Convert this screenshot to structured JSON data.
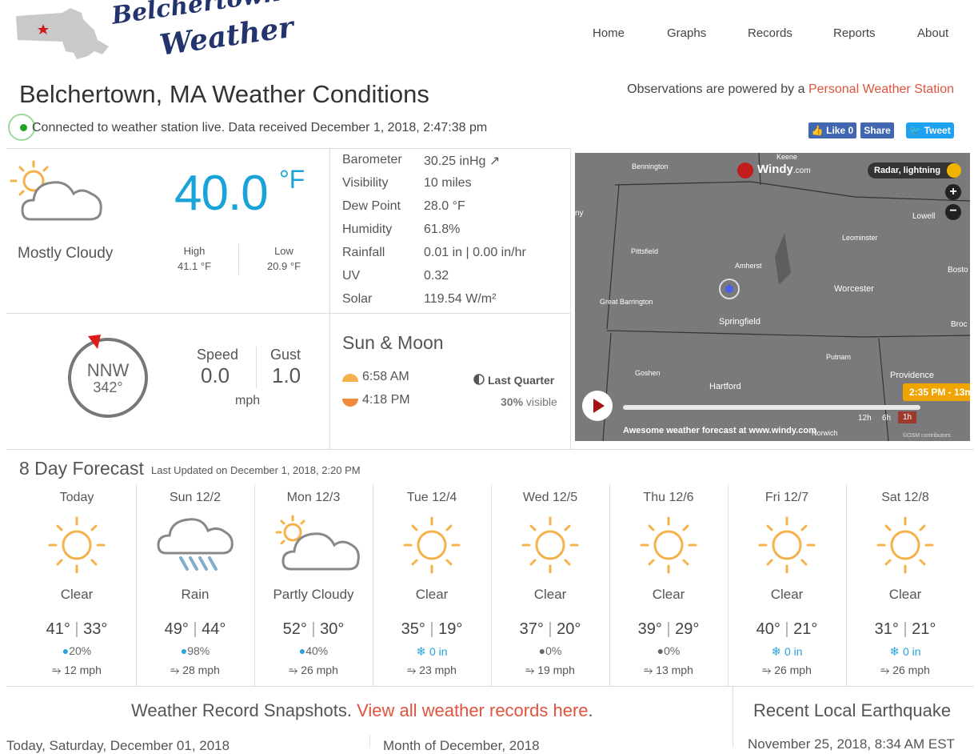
{
  "header": {
    "logo_line1": "Belchertown",
    "logo_line2": "Weather",
    "nav": [
      "Home",
      "Graphs",
      "Records",
      "Reports",
      "About"
    ]
  },
  "page_title": "Belchertown, MA Weather Conditions",
  "powered": {
    "prefix": "Observations are powered by a ",
    "link": "Personal Weather Station"
  },
  "status": "Connected to weather station live. Data received December 1, 2018, 2:47:38 pm",
  "social": {
    "like": "Like 0",
    "share": "Share",
    "tweet": "Tweet"
  },
  "current": {
    "temp": "40.0",
    "unit": "°F",
    "condition": "Mostly Cloudy",
    "high_label": "High",
    "high": "41.1 °F",
    "low_label": "Low",
    "low": "20.9 °F"
  },
  "observations": [
    {
      "k": "Barometer",
      "v": "30.25 inHg ↗"
    },
    {
      "k": "Visibility",
      "v": "10 miles"
    },
    {
      "k": "Dew Point",
      "v": "28.0 °F"
    },
    {
      "k": "Humidity",
      "v": "61.8%"
    },
    {
      "k": "Rainfall",
      "v": "0.01 in | 0.00 in/hr"
    },
    {
      "k": "UV",
      "v": "0.32"
    },
    {
      "k": "Solar",
      "v": "119.54 W/m²"
    }
  ],
  "wind": {
    "dir": "NNW",
    "deg": "342°",
    "speed_label": "Speed",
    "speed": "0.0",
    "gust_label": "Gust",
    "gust": "1.0",
    "unit": "mph"
  },
  "sun_moon": {
    "title": "Sun & Moon",
    "sunrise": "6:58 AM",
    "sunset": "4:18 PM",
    "phase": "Last Quarter",
    "visible_pct": "30%",
    "visible_label": " visible"
  },
  "map": {
    "brand": "Windy",
    "brand_suffix": ".com",
    "layer": "Radar, lightning",
    "time": "2:35 PM - 13m",
    "footer": "Awesome weather forecast at www.windy.com",
    "ranges": [
      "12h",
      "6h",
      "1h"
    ],
    "credit": "©OSM contributors",
    "places": [
      "Keene",
      "Bennington",
      "Lowell",
      "Leominster",
      "Pittsfield",
      "Amherst",
      "Bosto",
      "Worcester",
      "Great Barrington",
      "Springfield",
      "Broc",
      "Putnam",
      "Goshen",
      "Providence",
      "Hartford",
      "Norwich",
      "ny"
    ]
  },
  "forecast": {
    "title": "8 Day Forecast",
    "updated": "Last Updated on December 1, 2018, 2:20 PM",
    "days": [
      {
        "name": "Today",
        "cond": "Clear",
        "icon": "sun-icon",
        "hi": "41°",
        "lo": "33°",
        "prec": "20%",
        "prec_type": "rain",
        "wind": "12 mph"
      },
      {
        "name": "Sun 12/2",
        "cond": "Rain",
        "icon": "rain-icon",
        "hi": "49°",
        "lo": "44°",
        "prec": "98%",
        "prec_type": "rain",
        "wind": "28 mph"
      },
      {
        "name": "Mon 12/3",
        "cond": "Partly Cloudy",
        "icon": "partly-cloudy-icon",
        "hi": "52°",
        "lo": "30°",
        "prec": "40%",
        "prec_type": "rain",
        "wind": "26 mph"
      },
      {
        "name": "Tue 12/4",
        "cond": "Clear",
        "icon": "sun-icon",
        "hi": "35°",
        "lo": "19°",
        "prec": "0 in",
        "prec_type": "snow",
        "wind": "23 mph"
      },
      {
        "name": "Wed 12/5",
        "cond": "Clear",
        "icon": "sun-icon",
        "hi": "37°",
        "lo": "20°",
        "prec": "0%",
        "prec_type": "dry",
        "wind": "19 mph"
      },
      {
        "name": "Thu 12/6",
        "cond": "Clear",
        "icon": "sun-icon",
        "hi": "39°",
        "lo": "29°",
        "prec": "0%",
        "prec_type": "dry",
        "wind": "13 mph"
      },
      {
        "name": "Fri 12/7",
        "cond": "Clear",
        "icon": "sun-icon",
        "hi": "40°",
        "lo": "21°",
        "prec": "0 in",
        "prec_type": "snow",
        "wind": "26 mph"
      },
      {
        "name": "Sat 12/8",
        "cond": "Clear",
        "icon": "sun-icon",
        "hi": "31°",
        "lo": "21°",
        "prec": "0 in",
        "prec_type": "snow",
        "wind": "26 mph"
      }
    ]
  },
  "records": {
    "prefix": "Weather Record Snapshots. ",
    "link": "View all weather records here",
    "suffix": ".",
    "today": "Today, Saturday, December 01, 2018",
    "month": "Month of December, 2018"
  },
  "earthquake": {
    "title": "Recent Local Earthquake",
    "date": "November 25, 2018, 8:34 AM EST"
  },
  "colors": {
    "accent": "#1aa3d8",
    "link": "#e0533e",
    "sun": "#f5b14a",
    "logo": "#22336d"
  }
}
